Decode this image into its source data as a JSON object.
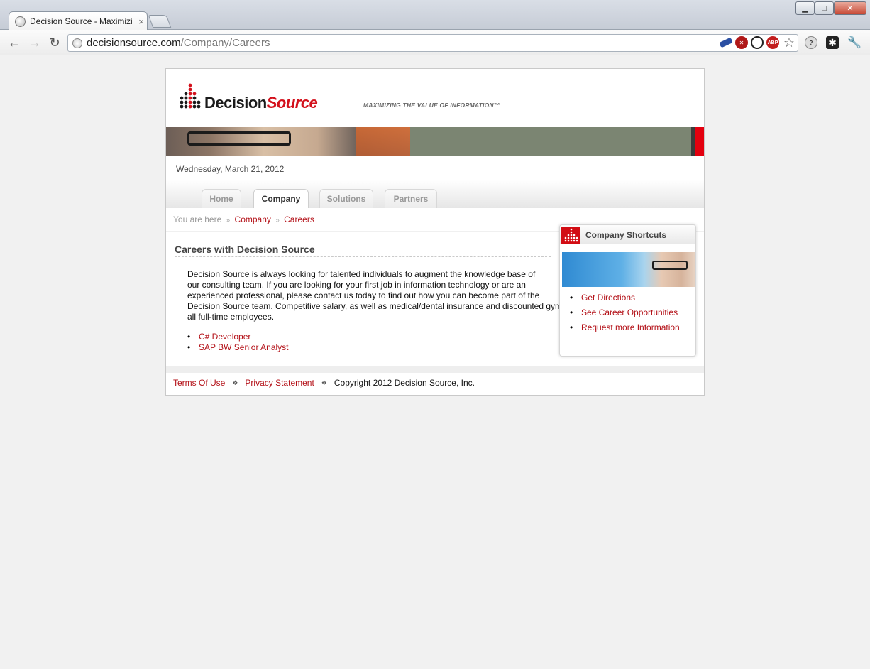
{
  "browser": {
    "tab_title": "Decision Source - Maximizi",
    "tab_close": "×",
    "url_host": "decisionsource.com",
    "url_path": "/Company/Careers",
    "nav_back": "←",
    "nav_forward": "→",
    "nav_reload": "↻",
    "win_min": "▁",
    "win_max": "□",
    "win_close": "✕",
    "star": "☆",
    "wrench": "🔧",
    "ext_abp": "ABP",
    "ext_grid": "✱",
    "ext_blocked": "✕",
    "ext_chat": "?",
    "icons": [
      "globe-icon",
      "back-arrow-icon",
      "forward-arrow-icon",
      "reload-icon",
      "star-icon",
      "wrench-icon"
    ]
  },
  "site": {
    "logo_primary": "Decision",
    "logo_accent": "Source",
    "tagline": "MAXIMIZING THE VALUE OF INFORMATION™",
    "date": "Wednesday, March 21, 2012",
    "accent_color": "#b30f16",
    "nav": {
      "home": "Home",
      "company": "Company",
      "solutions": "Solutions",
      "partners": "Partners"
    },
    "breadcrumb": {
      "prefix": "You are here",
      "sep1": "»",
      "item1": "Company",
      "sep2": "»",
      "item2": "Careers"
    },
    "heading": "Careers with Decision Source",
    "paragraph_lines": [
      "Decision Source is always looking for talented individuals to augment the knowledge base of",
      "our consulting team. If you are looking for your first job in information technology or are an",
      "experienced professional, please contact us today to find out how you can become part of the",
      "Decision Source team. Competitive salary, as well as medical/dental insurance and discounted gym membership are available to",
      "all full-time employees."
    ],
    "jobs": [
      "C# Developer",
      "SAP BW Senior Analyst"
    ],
    "footer": {
      "terms": "Terms Of Use",
      "sep1": "❖",
      "privacy": "Privacy Statement",
      "sep2": "❖",
      "copyright": "Copyright 2012 Decision Source, Inc."
    },
    "shortcuts": {
      "title": "Company Shortcuts",
      "links": [
        "Get Directions",
        "See Career Opportunities",
        "Request more Information"
      ]
    }
  }
}
